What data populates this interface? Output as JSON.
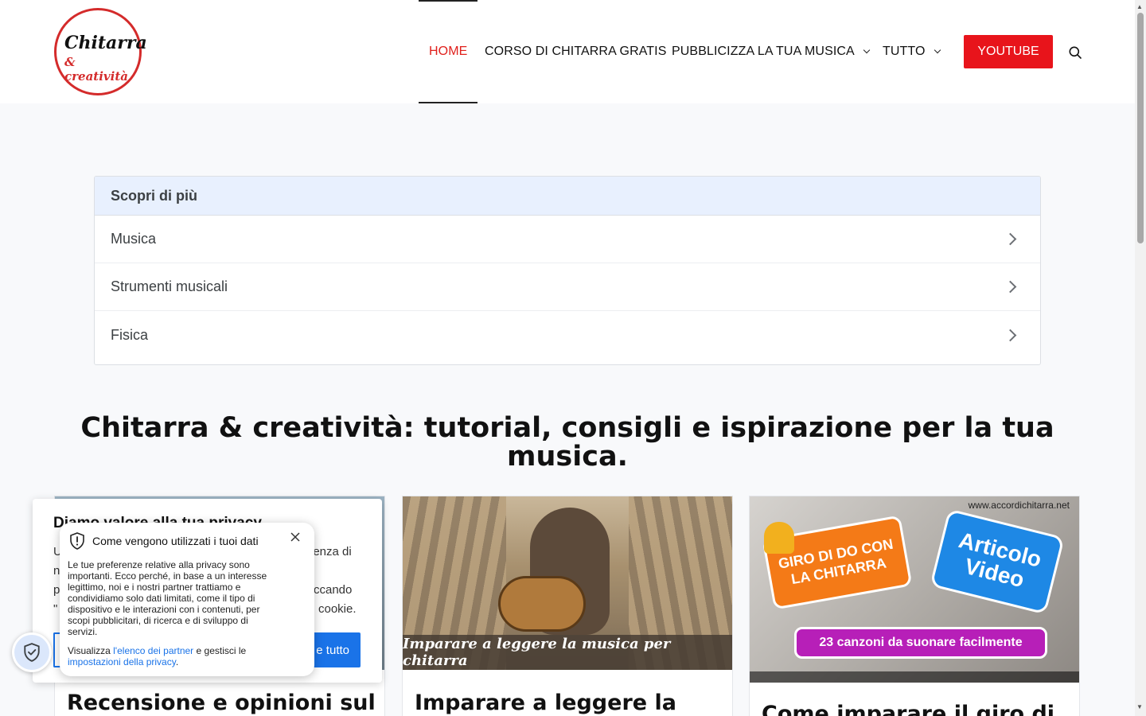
{
  "logo": {
    "line1": "Chitarra",
    "line2": "& creatività"
  },
  "nav": {
    "items": [
      {
        "label": "HOME"
      },
      {
        "label": "CORSO DI CHITARRA GRATIS"
      },
      {
        "label": "PUBBLICIZZA LA TUA MUSICA"
      },
      {
        "label": "TUTTO"
      }
    ],
    "youtube_label": "YOUTUBE"
  },
  "colors": {
    "accent": "#e0201c",
    "youtube": "#e8141b",
    "link": "#1a73e8",
    "discover_head": "#e8f0fe"
  },
  "icons": [
    "search-icon",
    "chevron-down-icon",
    "chevron-right-icon",
    "shield-icon",
    "close-icon"
  ],
  "discover": {
    "title": "Scopri di più",
    "items": [
      "Musica",
      "Strumenti musicali",
      "Fisica"
    ]
  },
  "page_title": "Chitarra & creatività: tutorial, consigli e ispirazione per la tua musica.",
  "cards": [
    {
      "title": "Recensione e opinioni sul"
    },
    {
      "title": "Imparare a leggere la",
      "banner": "Imparare a leggere la musica per chitarra"
    },
    {
      "title": "Come imparare il giro di",
      "url": "www.accordichitarra.net",
      "badge_orange": "GIRO DI DO CON LA CHITARRA",
      "badge_blue": "Articolo Video",
      "pill": "23 canzoni da suonare facilmente"
    }
  ],
  "privacy": {
    "title": "Diamo valore alla tua privacy",
    "lines": [
      "U",
      "n",
      "p",
      "\""
    ],
    "right_fragments": [
      "ienza di",
      "ccando",
      "cookie."
    ],
    "accept_label": "e tutto",
    "detail_title": "Come vengono utilizzati i tuoi dati",
    "detail_body": "Le tue preferenze relative alla privacy sono importanti. Ecco perché, in base a un interesse legittimo, noi e i nostri partner trattiamo e condividiamo solo dati limitati, come il tipo di dispositivo e le interazioni con i contenuti, per scopi pubblicitari, di ricerca e di sviluppo di servizi.",
    "foot_prefix": "Visualizza ",
    "foot_link1": "l'elenco dei partner",
    "foot_mid": " e gestisci le ",
    "foot_link2": "impostazioni della privacy",
    "foot_suffix": "."
  }
}
